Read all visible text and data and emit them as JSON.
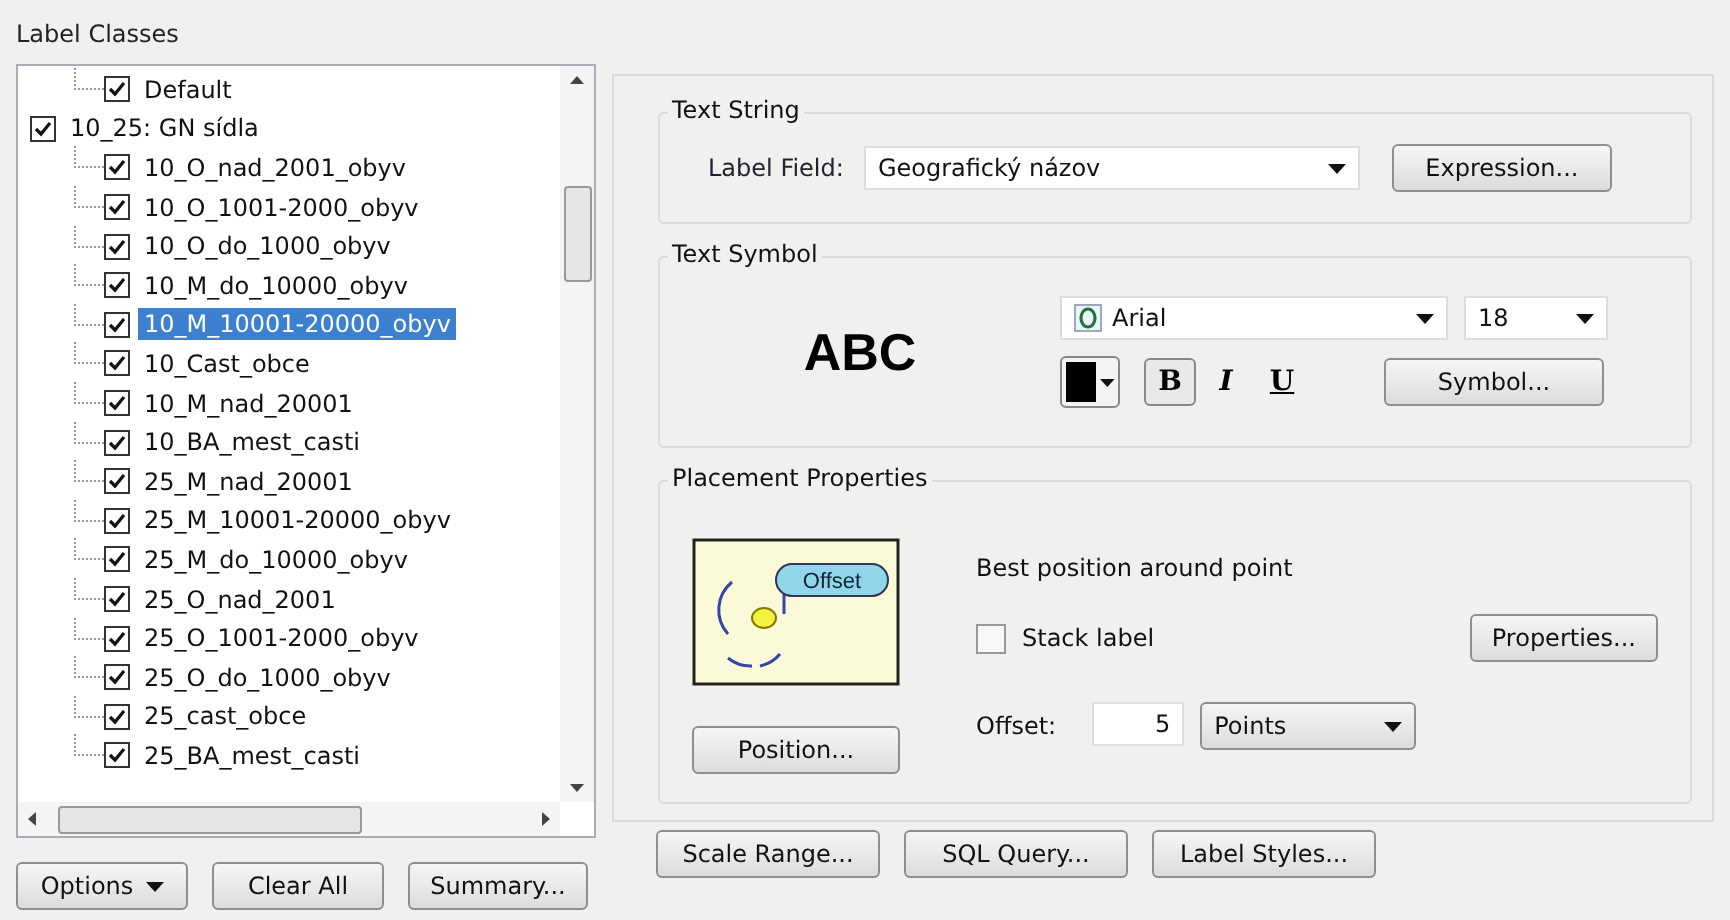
{
  "label_classes": {
    "title": "Label Classes",
    "tree": [
      {
        "children": [
          {
            "label": "Default",
            "checked": true,
            "selected": false
          }
        ]
      },
      {
        "label": "10_25: GN sídla",
        "checked": true,
        "selected": false,
        "children": [
          {
            "label": "10_O_nad_2001_obyv",
            "checked": true,
            "selected": false
          },
          {
            "label": "10_O_1001-2000_obyv",
            "checked": true,
            "selected": false
          },
          {
            "label": "10_O_do_1000_obyv",
            "checked": true,
            "selected": false
          },
          {
            "label": "10_M_do_10000_obyv",
            "checked": true,
            "selected": false
          },
          {
            "label": "10_M_10001-20000_obyv",
            "checked": true,
            "selected": true
          },
          {
            "label": "10_Cast_obce",
            "checked": true,
            "selected": false
          },
          {
            "label": "10_M_nad_20001",
            "checked": true,
            "selected": false
          },
          {
            "label": "10_BA_mest_casti",
            "checked": true,
            "selected": false
          },
          {
            "label": "25_M_nad_20001",
            "checked": true,
            "selected": false
          },
          {
            "label": "25_M_10001-20000_obyv",
            "checked": true,
            "selected": false
          },
          {
            "label": "25_M_do_10000_obyv",
            "checked": true,
            "selected": false
          },
          {
            "label": "25_O_nad_2001",
            "checked": true,
            "selected": false
          },
          {
            "label": "25_O_1001-2000_obyv",
            "checked": true,
            "selected": false
          },
          {
            "label": "25_O_do_1000_obyv",
            "checked": true,
            "selected": false
          },
          {
            "label": "25_cast_obce",
            "checked": true,
            "selected": false
          },
          {
            "label": "25_BA_mest_casti",
            "checked": true,
            "selected": false
          }
        ]
      }
    ],
    "buttons": [
      {
        "label": "Options",
        "dropdown": true
      },
      {
        "label": "Clear All",
        "dropdown": false
      },
      {
        "label": "Summary...",
        "dropdown": false
      }
    ]
  },
  "text_string": {
    "title": "Text String",
    "field_label": "Label Field:",
    "field_value": "Geografický názov",
    "button": "Expression..."
  },
  "text_symbol": {
    "title": "Text Symbol",
    "preview": "ABC",
    "font": "Arial",
    "size": "18",
    "color": "#000000",
    "bold": true,
    "italic": false,
    "underline": false,
    "bold_key": "B",
    "italic_key": "I",
    "underline_key": "U",
    "button": "Symbol..."
  },
  "placement": {
    "title": "Placement Properties",
    "diagram_label": "Offset",
    "description": "Best position around point",
    "stack_label": {
      "label": "Stack label",
      "checked": false
    },
    "properties_button": "Properties...",
    "position_button": "Position...",
    "offset_label": "Offset:",
    "offset_value": "5",
    "unit": "Points"
  },
  "bottom_buttons": [
    "Scale Range...",
    "SQL Query...",
    "Label Styles..."
  ]
}
